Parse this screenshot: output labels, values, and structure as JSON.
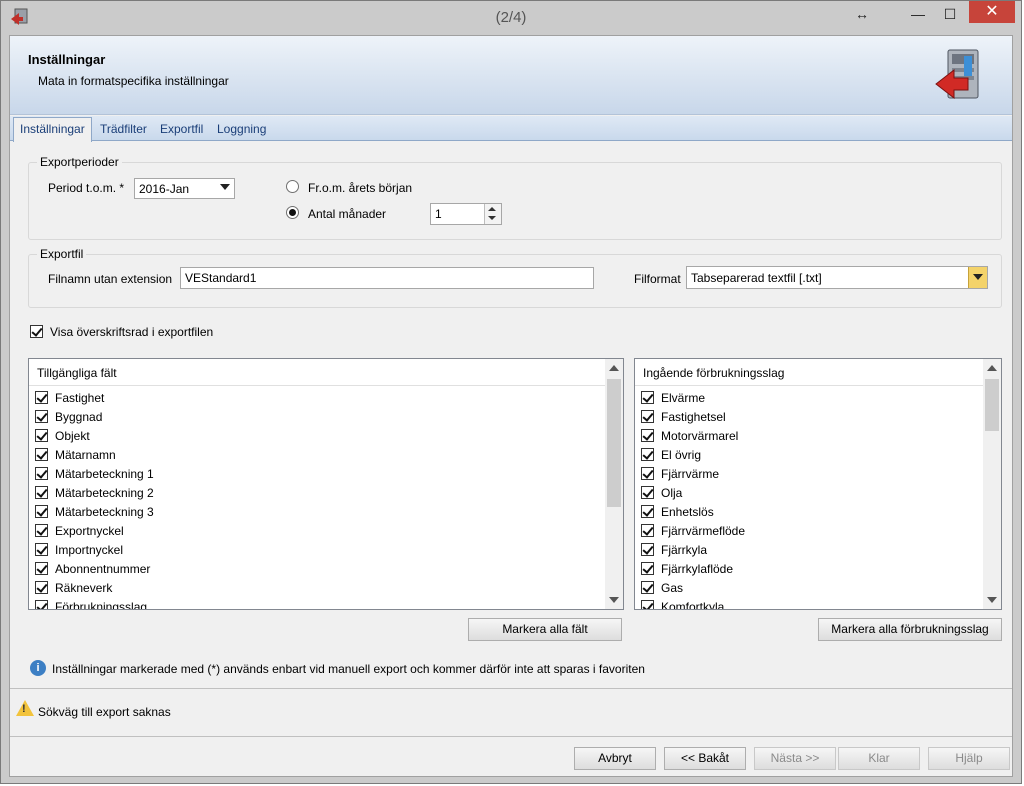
{
  "window": {
    "title": "(2/4)",
    "controls": {
      "restore": "↔",
      "minimize": "—",
      "maximize": "☐",
      "close": "✕"
    }
  },
  "header": {
    "title": "Inställningar",
    "subtitle": "Mata in formatspecifika inställningar",
    "icon": "server-export-icon"
  },
  "tabs": [
    {
      "label": "Inställningar",
      "active": true
    },
    {
      "label": "Trädfilter",
      "active": false
    },
    {
      "label": "Exportfil",
      "active": false
    },
    {
      "label": "Loggning",
      "active": false
    }
  ],
  "exportperioder": {
    "legend": "Exportperioder",
    "period_label": "Period t.o.m. *",
    "period_value": "2016-Jan",
    "radio_from_start": "Fr.o.m. årets början",
    "radio_months": "Antal månader",
    "selected_radio": "months",
    "months_value": "1"
  },
  "exportfil": {
    "legend": "Exportfil",
    "filename_label": "Filnamn utan extension",
    "filename_value": "VEStandard1",
    "format_label": "Filformat",
    "format_value": "Tabseparerad textfil [.txt]"
  },
  "show_header_row": {
    "label": "Visa överskriftsrad i exportfilen",
    "checked": true
  },
  "available_fields": {
    "header": "Tillgängliga fält",
    "items": [
      "Fastighet",
      "Byggnad",
      "Objekt",
      "Mätarnamn",
      "Mätarbeteckning 1",
      "Mätarbeteckning 2",
      "Mätarbeteckning 3",
      "Exportnyckel",
      "Importnyckel",
      "Abonnentnummer",
      "Räkneverk",
      "Förbrukningsslag"
    ],
    "button": "Markera alla fält"
  },
  "consumption_types": {
    "header": "Ingående förbrukningsslag",
    "items": [
      "Elvärme",
      "Fastighetsel",
      "Motorvärmarel",
      "El övrig",
      "Fjärrvärme",
      "Olja",
      "Enhetslös",
      "Fjärrvärmeflöde",
      "Fjärrkyla",
      "Fjärrkylaflöde",
      "Gas",
      "Komfortkyla"
    ],
    "button": "Markera alla förbrukningsslag"
  },
  "info_text": "Inställningar markerade med (*) används enbart vid manuell export och kommer därför inte att sparas i favoriten",
  "status": {
    "warning_text": "Sökväg till export saknas"
  },
  "footer": {
    "cancel": "Avbryt",
    "back": "<< Bakåt",
    "next": "Nästa >>",
    "finish": "Klar",
    "help": "Hjälp"
  },
  "colors": {
    "header_gradient": "#c8d7ea",
    "tab_text": "#1a3e78",
    "close_button": "#c7443a",
    "warning": "#f2c33b",
    "info": "#3c7fc4"
  }
}
